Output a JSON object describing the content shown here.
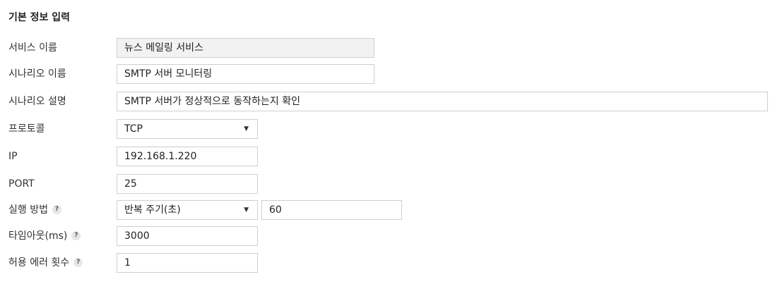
{
  "section_title": "기본 정보 입력",
  "fields": {
    "service_name": {
      "label": "서비스 이름",
      "value": "뉴스 메일링 서비스"
    },
    "scenario_name": {
      "label": "시나리오 이름",
      "value": "SMTP 서버 모니터링"
    },
    "scenario_desc": {
      "label": "시나리오 설명",
      "value": "SMTP 서버가 정상적으로 동작하는지 확인"
    },
    "protocol": {
      "label": "프로토콜",
      "value": "TCP"
    },
    "ip": {
      "label": "IP",
      "value": "192.168.1.220"
    },
    "port": {
      "label": "PORT",
      "value": "25"
    },
    "exec_method": {
      "label": "실행 방법",
      "value": "반복 주기(초)",
      "interval": "60"
    },
    "timeout": {
      "label": "타임아웃(ms)",
      "value": "3000"
    },
    "allowed_errors": {
      "label": "허용 에러 횟수",
      "value": "1"
    }
  },
  "help_glyph": "?",
  "dropdown_arrow": "▼",
  "colors": {
    "border": "#cfcfcf",
    "readonly_bg": "#f2f2f2",
    "help_bg": "#e6e6e6"
  }
}
